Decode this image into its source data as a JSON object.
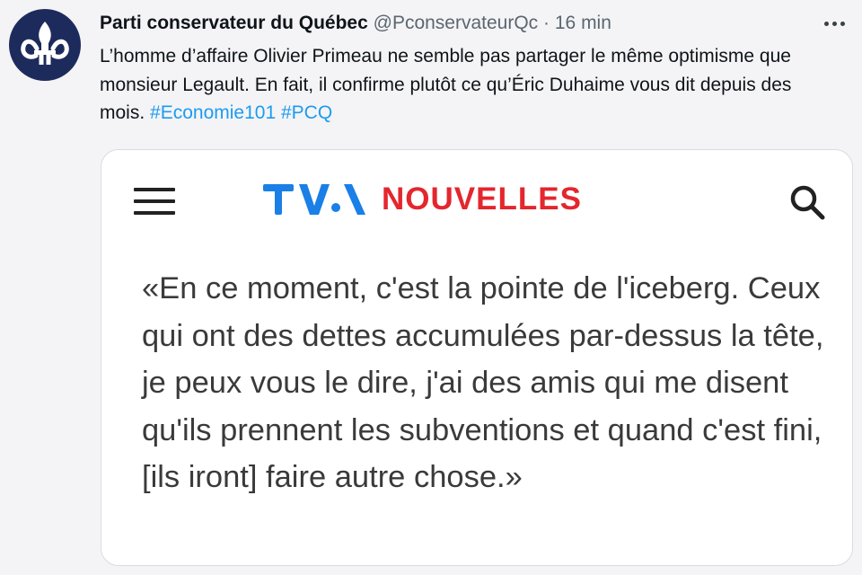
{
  "tweet": {
    "author_name": "Parti conservateur du Québec",
    "handle": "@PconservateurQc",
    "separator": "·",
    "time": "16 min",
    "text": "L’homme d’affaire Olivier Primeau ne semble pas partager le même optimisme que monsieur Legault. En fait, il confirme plutôt ce qu’Éric Duhaime vous dit depuis des mois.",
    "hashtags": [
      "#Economie101",
      "#PCQ"
    ]
  },
  "card": {
    "logo_mark": "TVA",
    "logo_text": "NOUVELLES",
    "quote": "«En ce moment, c'est la pointe de l'iceberg. Ceux qui ont des dettes accumulées par-dessus la tête, je peux vous le dire, j'ai des amis qui me disent qu'ils prennent les subventions et quand c'est fini, [ils iront] faire autre chose.»"
  },
  "icons": {
    "avatar": "fleur-de-lis-logo",
    "more": "more-horizontal-icon",
    "menu": "hamburger-menu-icon",
    "search": "search-icon"
  },
  "colors": {
    "hashtag": "#1d9bf0",
    "tva_blue": "#1a7fe6",
    "nouvelles_red": "#e4262d",
    "avatar_bg": "#1d2b5c"
  }
}
